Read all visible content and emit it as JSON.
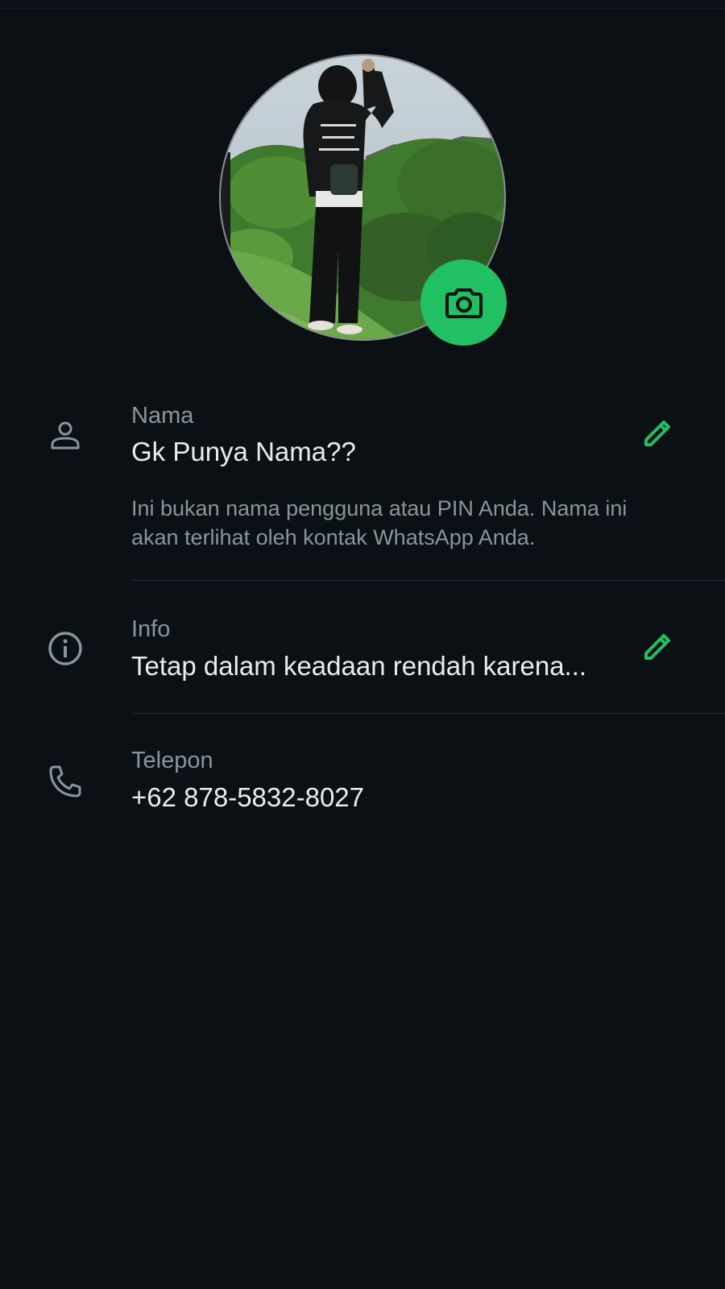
{
  "profile": {
    "avatar_alt": "Profile photo",
    "camera_icon": "camera-icon"
  },
  "fields": {
    "name": {
      "icon": "person-icon",
      "label": "Nama",
      "value": "Gk Punya Nama??",
      "help": "Ini bukan nama pengguna atau PIN Anda. Nama ini akan terlihat oleh kontak WhatsApp Anda.",
      "edit_icon": "pencil-icon"
    },
    "info": {
      "icon": "info-icon",
      "label": "Info",
      "value": "Tetap dalam keadaan rendah karena...",
      "edit_icon": "pencil-icon"
    },
    "phone": {
      "icon": "phone-icon",
      "label": "Telepon",
      "value": "+62 878-5832-8027"
    }
  },
  "colors": {
    "background": "#0b1014",
    "accent": "#21c063",
    "primary_text": "#e9edef",
    "secondary_text": "#8696a0"
  }
}
